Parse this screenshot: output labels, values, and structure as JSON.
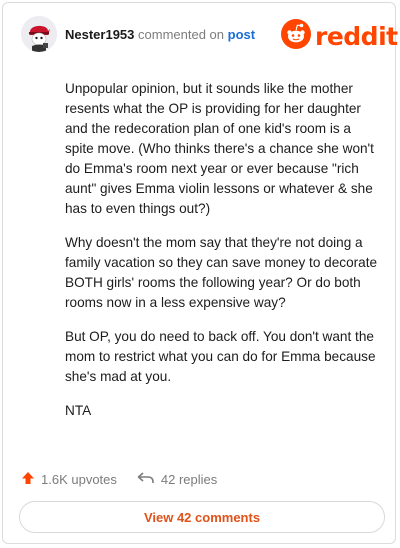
{
  "header": {
    "username": "Nester1953",
    "action_text": "commented on",
    "post_link": "post",
    "brand": "reddit"
  },
  "comment": {
    "paragraphs": [
      "Unpopular opinion, but it sounds like the mother resents what the OP is providing for her daughter and the redecoration plan of one kid's room is a spite move. (Who thinks there's a chance she won't do Emma's room next year or ever because \"rich aunt\" gives Emma violin lessons or whatever & she has to even things out?)",
      "Why doesn't the mom say that they're not doing a family vacation so they can save money to decorate BOTH girls' rooms the following year? Or do both rooms now in a less expensive way?",
      "But OP, you do need to back off. You don't want the mom to restrict what you can do for Emma because she's mad at you.",
      "NTA"
    ]
  },
  "actions": {
    "upvotes": "1.6K upvotes",
    "replies": "42 replies"
  },
  "footer": {
    "view_comments": "View 42 comments"
  },
  "colors": {
    "brand": "#ff4500",
    "link": "#1a6fd6",
    "upvote": "#ff4500"
  },
  "icons": [
    "user-avatar",
    "reddit-snoo-icon",
    "upvote-arrow-icon",
    "reply-arrow-icon"
  ]
}
